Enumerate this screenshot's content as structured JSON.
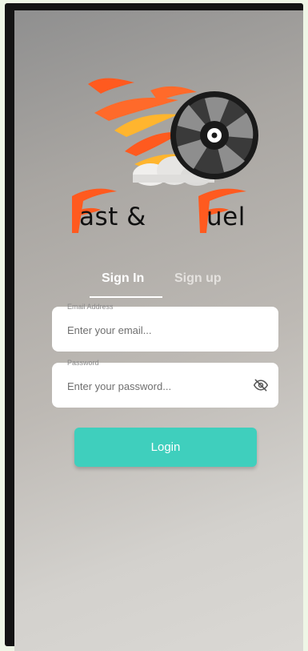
{
  "brand": {
    "name_left": "ast &",
    "name_right": "uel"
  },
  "tabs": [
    {
      "label": "Sign In",
      "active": true
    },
    {
      "label": "Sign up",
      "active": false
    }
  ],
  "form": {
    "email": {
      "label": "Email Address",
      "placeholder": "Enter your email...",
      "value": ""
    },
    "password": {
      "label": "Password",
      "placeholder": "Enter your password...",
      "value": ""
    },
    "submit_label": "Login"
  },
  "icons": {
    "visibility_toggle": "eye-off-icon",
    "logo": "flaming-wheel-logo"
  },
  "colors": {
    "accent": "#3fcfbd",
    "flame_orange": "#ff5a1f",
    "flame_yellow": "#ffb52e"
  }
}
